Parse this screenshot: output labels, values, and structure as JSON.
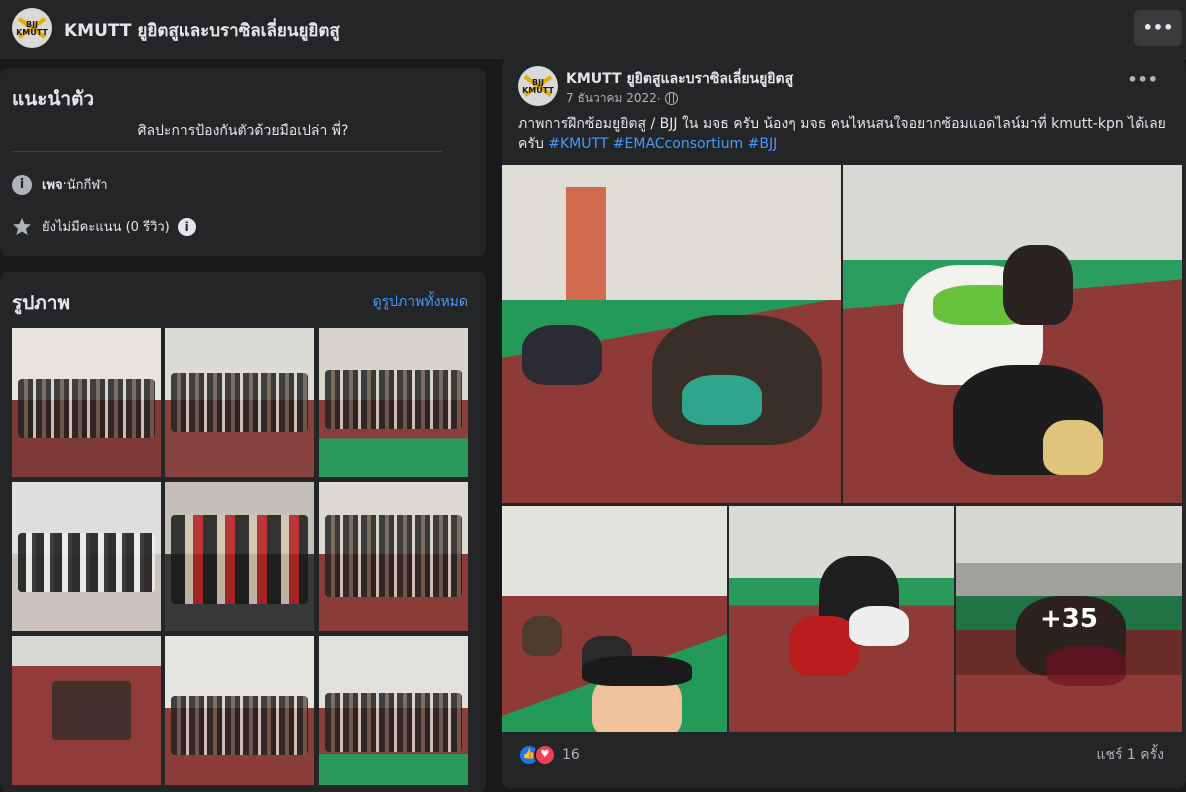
{
  "header": {
    "page_name": "KMUTT ยูยิตสูและบราซิลเลี่ยนยูยิตสู",
    "logo_text_top": "BJJ",
    "logo_text_bottom": "KMUTT",
    "more_label": "•••"
  },
  "intro": {
    "title": "แนะนำตัว",
    "bio": "ศิลปะการป้องกันตัวด้วยมือเปล่า พี่?",
    "category_label": "เพจ",
    "category_sep": " · ",
    "category_value": "นักกีฬา",
    "rating_text": "ยังไม่มีคะแนน (0 รีวิว)",
    "info_icon": "i"
  },
  "photos": {
    "title": "รูปภาพ",
    "see_all": "ดูรูปภาพทั้งหมด"
  },
  "post": {
    "author": "KMUTT ยูยิตสูและบราซิลเลี่ยนยูยิตสู",
    "date": "7 ธันวาคม 2022",
    "date_sep": " · ",
    "menu": "•••",
    "text": "ภาพการฝึกซ้อมยูยิตสู / BJJ ใน มจธ ครับ น้องๆ มจธ คนไหนสนใจอยากซ้อมแอดไลน์มาที่ kmutt-kpn ได้เลยครับ ",
    "hashtags": [
      "#KMUTT",
      "#EMACconsortium",
      "#BJJ"
    ],
    "more_photos": "+35",
    "reaction_count": "16",
    "shares": "แชร์ 1 ครั้ง"
  },
  "colors": {
    "background": "#18191a",
    "card": "#242526",
    "link": "#4599ff",
    "mat_red": "#8e3b37",
    "mat_green": "#239a5a",
    "like": "#1877f2",
    "love": "#f33e58"
  }
}
